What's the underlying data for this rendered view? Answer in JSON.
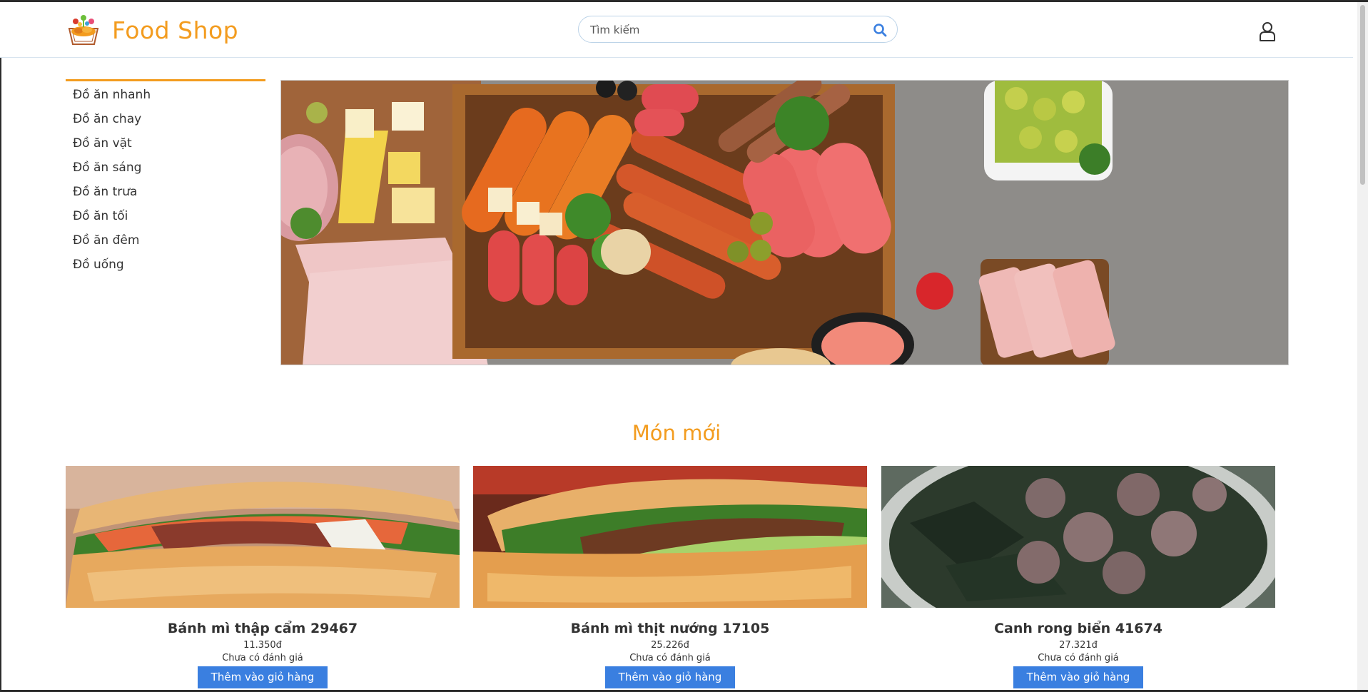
{
  "header": {
    "brand": "Food Shop",
    "search_placeholder": "Tìm kiếm"
  },
  "sidebar": {
    "items": [
      {
        "label": "Đồ ăn nhanh"
      },
      {
        "label": "Đồ ăn chay"
      },
      {
        "label": "Đồ ăn vặt"
      },
      {
        "label": "Đồ ăn sáng"
      },
      {
        "label": "Đồ ăn trưa"
      },
      {
        "label": "Đồ ăn tối"
      },
      {
        "label": "Đồ ăn đêm"
      },
      {
        "label": "Đồ uống"
      }
    ]
  },
  "section": {
    "title": "Món mới"
  },
  "products": [
    {
      "name": "Bánh mì thập cẩm 29467",
      "price": "11.350đ",
      "rating": "Chưa có đánh giá",
      "button": "Thêm vào giỏ hàng"
    },
    {
      "name": "Bánh mì thịt nướng 17105",
      "price": "25.226đ",
      "rating": "Chưa có đánh giá",
      "button": "Thêm vào giỏ hàng"
    },
    {
      "name": "Canh rong biển 41674",
      "price": "27.321đ",
      "rating": "Chưa có đánh giá",
      "button": "Thêm vào giỏ hàng"
    }
  ],
  "colors": {
    "accent": "#f39c1f",
    "button": "#3a7fe0"
  },
  "icons": {
    "logo": "food-basket-icon",
    "search": "search-icon",
    "user": "user-icon"
  }
}
